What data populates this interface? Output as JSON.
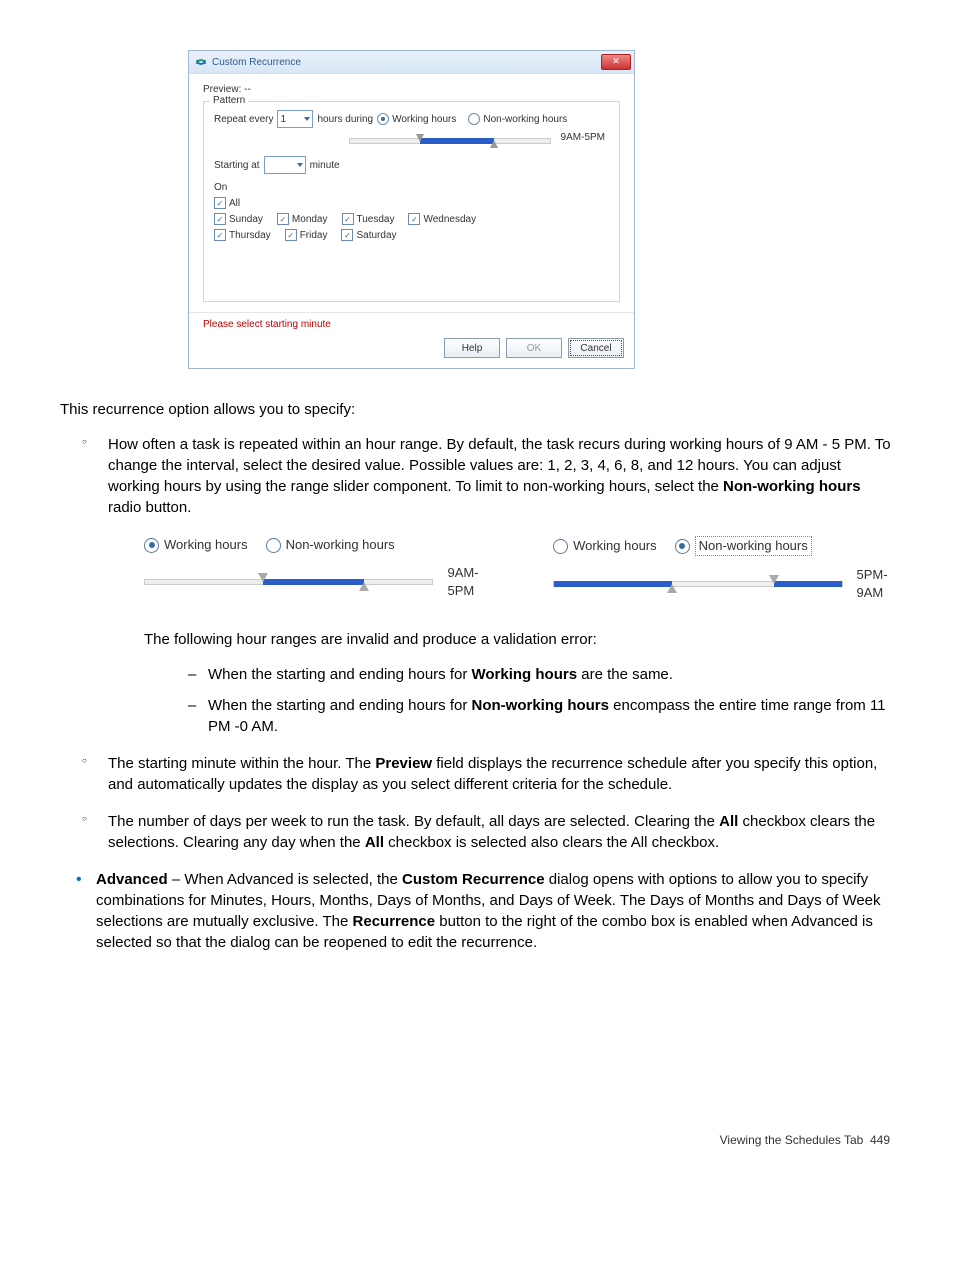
{
  "dialog": {
    "title": "Custom Recurrence",
    "preview_label": "Preview:",
    "preview_value": "--",
    "pattern_legend": "Pattern",
    "repeat_every": "Repeat every",
    "repeat_value": "1",
    "hours_during": "hours during",
    "radio_working": "Working hours",
    "radio_nonworking": "Non-working hours",
    "range_label": "9AM-5PM",
    "starting_at": "Starting at",
    "minute": "minute",
    "on": "On",
    "days": {
      "all": "All",
      "sunday": "Sunday",
      "monday": "Monday",
      "tuesday": "Tuesday",
      "wednesday": "Wednesday",
      "thursday": "Thursday",
      "friday": "Friday",
      "saturday": "Saturday"
    },
    "validation": "Please select starting minute",
    "help": "Help",
    "ok": "OK",
    "cancel": "Cancel"
  },
  "text": {
    "intro": "This recurrence option allows you to specify:",
    "b1_a": "How often a task is repeated within an hour range. By default, the task recurs during working hours of 9 AM - 5 PM. To change the interval, select the desired value. Possible values are: 1, 2, 3, 4, 6, 8, and 12 hours. You can adjust working hours by using the range slider component. To limit to non-working hours, select the ",
    "b1_bold": "Non-working hours",
    "b1_b": " radio button.",
    "ex_working": "Working hours",
    "ex_nonworking": "Non-working hours",
    "ex_range1": "9AM-5PM",
    "ex_range2": "5PM-9AM",
    "invalid_intro": "The following hour ranges are invalid and produce a validation error:",
    "d1_a": "When the starting and ending hours for ",
    "d1_bold": "Working hours",
    "d1_b": " are the same.",
    "d2_a": "When the starting and ending hours for ",
    "d2_bold": "Non-working hours",
    "d2_b": " encompass the entire time range from 11 PM -0 AM.",
    "b2_a": "The starting minute within the hour. The ",
    "b2_bold": "Preview",
    "b2_b": " field displays the recurrence schedule after you specify this option, and automatically updates the display as you select different criteria for the schedule.",
    "b3_a": "The number of days per week to run the task. By default, all days are selected. Clearing the ",
    "b3_bold1": "All",
    "b3_mid": " checkbox clears the selections. Clearing any day when the ",
    "b3_bold2": "All",
    "b3_b": " checkbox is selected also clears the All checkbox.",
    "adv_bold1": "Advanced",
    "adv_a": " – When Advanced is selected, the ",
    "adv_bold2": "Custom Recurrence",
    "adv_b": " dialog opens with options to allow you to specify combinations for Minutes, Hours, Months, Days of Months, and Days of Week. The Days of Months and Days of Week selections are mutually exclusive. The ",
    "adv_bold3": "Recurrence",
    "adv_c": " button to the right of the combo box is enabled when Advanced is selected so that the dialog can be reopened to edit the recurrence."
  },
  "footer": {
    "label": "Viewing the Schedules Tab",
    "page": "449"
  }
}
